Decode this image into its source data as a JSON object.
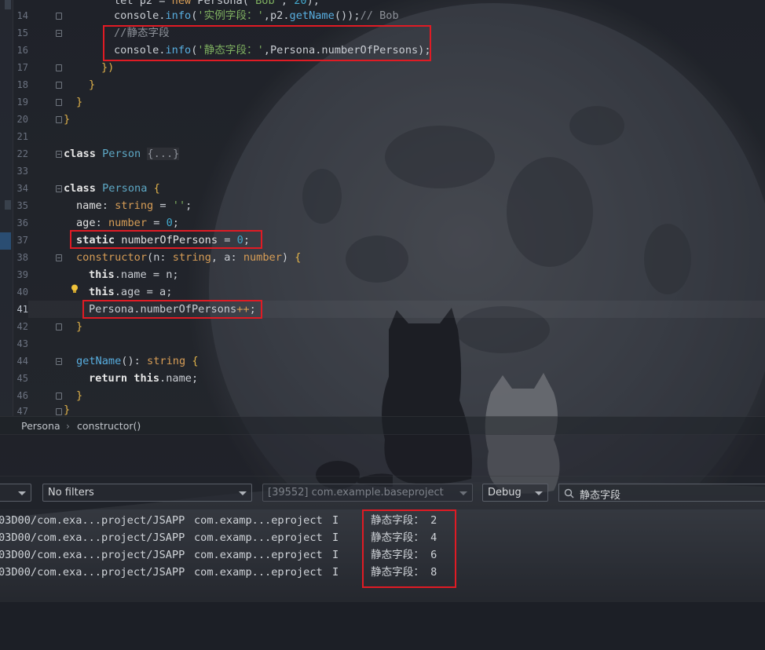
{
  "editor": {
    "line_numbers": [
      "14",
      "15",
      "16",
      "17",
      "18",
      "19",
      "20",
      "21",
      "22",
      "33",
      "34",
      "35",
      "36",
      "37",
      "38",
      "39",
      "40",
      "41",
      "42",
      "43",
      "44",
      "45",
      "46",
      "47"
    ],
    "current_line": "41",
    "lines": {
      "l14": {
        "a": "let p2 = ",
        "b": "new",
        "c": " Persona(",
        "d": "'Bob'",
        "e": ", ",
        "f": "20",
        "g": ");"
      },
      "l14b": {
        "a": "console.",
        "b": "info",
        "c": "(",
        "d": "'实例字段：'",
        "e": ",p2.",
        "f": "getName",
        "g": "());",
        "h": "// Bob"
      },
      "l15": "//静态字段",
      "l16": {
        "a": "console.",
        "b": "info",
        "c": "(",
        "d": "'静态字段：'",
        "e": ",Persona.numberOfPersons);"
      },
      "l17": "})",
      "l18": "}",
      "l19": "}",
      "l20": "}",
      "l22": {
        "kw": "class",
        "name": "Person",
        "folded": "{...}"
      },
      "l34": {
        "kw": "class",
        "name": "Persona",
        "brace": "{"
      },
      "l35": {
        "field": "name",
        "sep": ": ",
        "type": "string",
        "rest": " = ",
        "val": "''",
        "end": ";"
      },
      "l36": {
        "field": "age",
        "sep": ": ",
        "type": "number",
        "rest": " = ",
        "val": "0",
        "end": ";"
      },
      "l37": {
        "kw": "static",
        "field": " numberOfPersons",
        "rest": " = ",
        "val": "0",
        "end": ";"
      },
      "l38": {
        "kw": "constructor",
        "p1": "(n: ",
        "t1": "string",
        "p2": ", a: ",
        "t2": "number",
        "p3": ") ",
        "brace": "{"
      },
      "l39": {
        "kw": "this",
        "rest": ".name = n;"
      },
      "l40": {
        "kw": "this",
        "rest": ".age = a;"
      },
      "l41": {
        "a": "Persona.numberOfPersons",
        "b": "++",
        "c": ";"
      },
      "l42": "}",
      "l44": {
        "fn": "getName",
        "p": "(): ",
        "type": "string",
        "brace": " {"
      },
      "l45": {
        "kw": "return",
        "kw2": " this",
        "rest": ".name;"
      },
      "l46": "}",
      "l47": "}"
    }
  },
  "breadcrumb": {
    "items": [
      "Persona",
      "constructor()"
    ],
    "separator": "›"
  },
  "logcat": {
    "filter_dropdown": "No filters",
    "process_dropdown": "[39552] com.example.baseproject",
    "level_dropdown": "Debug",
    "search_value": "静态字段",
    "rows": [
      {
        "tag": "03D00/com.exa...project/JSAPP",
        "pkg": "com.examp...eproject",
        "level": "I",
        "msg": "静态字段： 2"
      },
      {
        "tag": "03D00/com.exa...project/JSAPP",
        "pkg": "com.examp...eproject",
        "level": "I",
        "msg": "静态字段： 4"
      },
      {
        "tag": "03D00/com.exa...project/JSAPP",
        "pkg": "com.examp...eproject",
        "level": "I",
        "msg": "静态字段： 6"
      },
      {
        "tag": "03D00/com.exa...project/JSAPP",
        "pkg": "com.examp...eproject",
        "level": "I",
        "msg": "静态字段： 8"
      }
    ]
  },
  "colors": {
    "highlight_box": "#e01b24",
    "keyword": "#d79d56",
    "string": "#7fb060",
    "function": "#58aee0"
  },
  "icons": [
    "lightbulb-icon",
    "search-icon",
    "chevron-down-icon",
    "fold-marker-icon"
  ]
}
